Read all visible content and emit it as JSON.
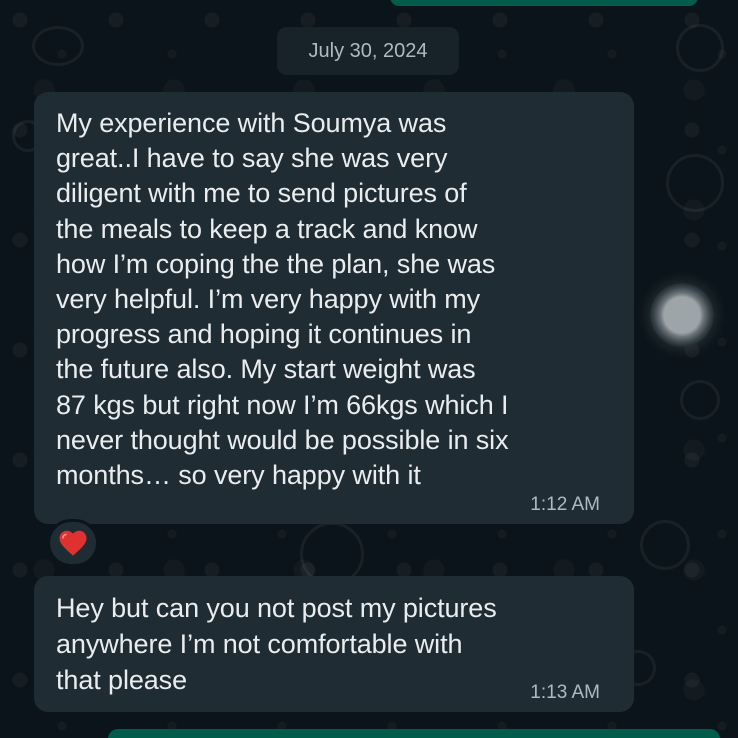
{
  "date": "July 30, 2024",
  "messages": [
    {
      "text": "My experience with Soumya was\ngreat..I have to say she was very\ndiligent with me to send pictures of\nthe meals to keep a track and know\nhow I’m coping the the plan, she was\nvery helpful. I’m very happy with my\nprogress and hoping it continues in\nthe future also. My start weight was\n87 kgs but right now I’m 66kgs which I\nnever thought would be possible in six\nmonths… so very happy with it",
      "time": "1:12 AM",
      "reaction": "red-heart"
    },
    {
      "text": "Hey but can you not post my pictures\nanywhere I’m not comfortable with\nthat please",
      "time": "1:13 AM"
    }
  ],
  "colors": {
    "background": "#0b141a",
    "incoming_bubble": "#202c33",
    "outgoing_bubble": "#005c4b",
    "reaction_heart": "#e03131"
  }
}
